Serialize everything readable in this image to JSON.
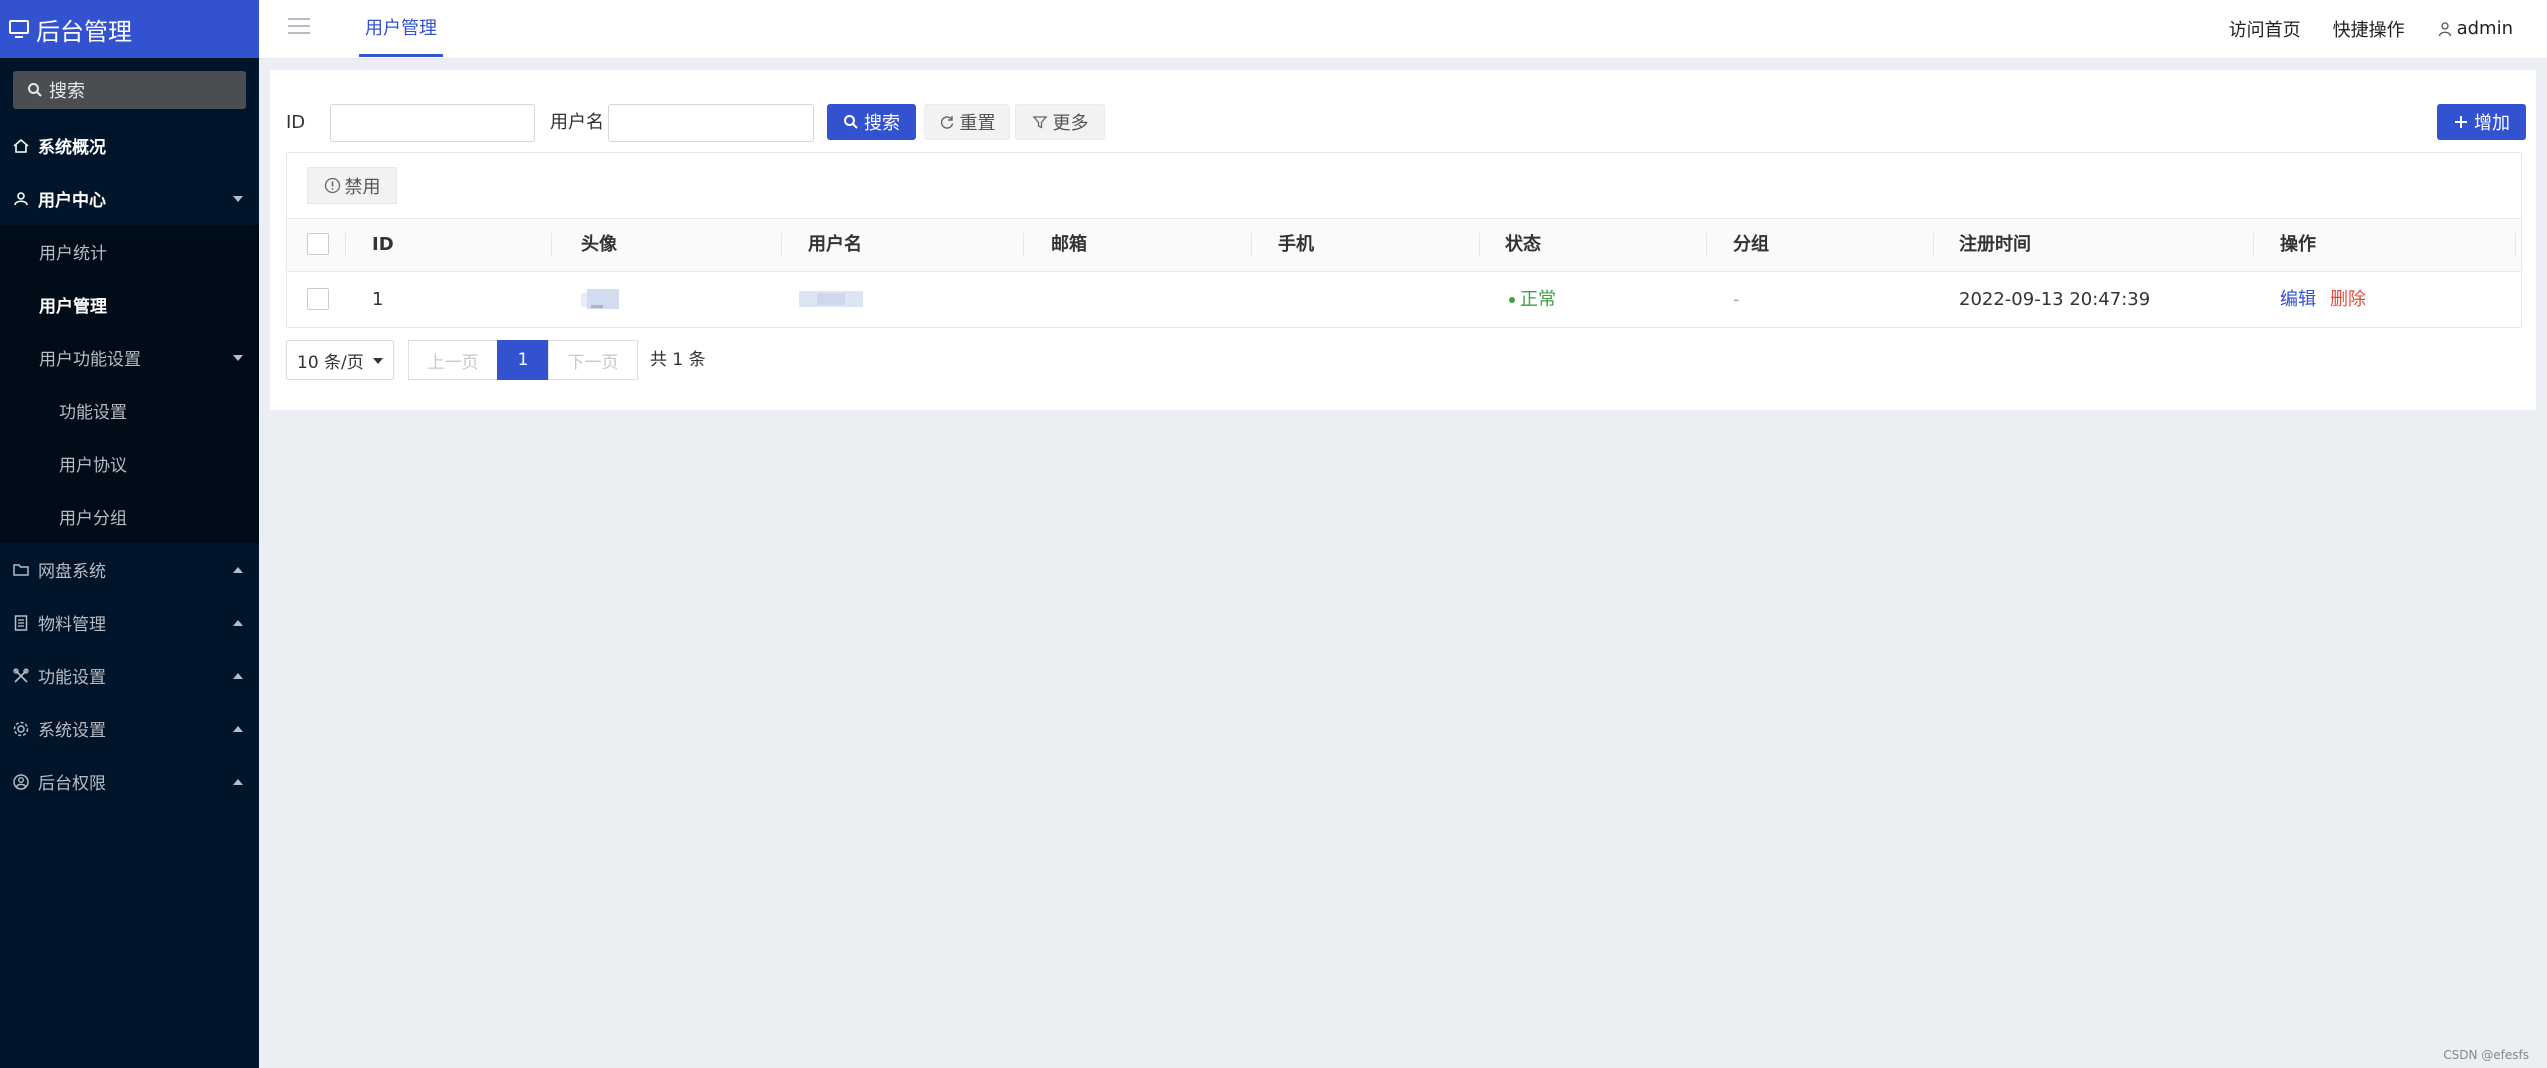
{
  "sidebar": {
    "brand": "后台管理",
    "search_label": "搜索",
    "items": [
      {
        "label": "系统概况"
      },
      {
        "label": "用户中心"
      },
      {
        "label": "网盘系统"
      },
      {
        "label": "物料管理"
      },
      {
        "label": "功能设置"
      },
      {
        "label": "系统设置"
      },
      {
        "label": "后台权限"
      }
    ],
    "user_center_sub": [
      {
        "label": "用户统计"
      },
      {
        "label": "用户管理"
      },
      {
        "label": "用户功能设置"
      }
    ],
    "user_func_sub": [
      {
        "label": "功能设置"
      },
      {
        "label": "用户协议"
      },
      {
        "label": "用户分组"
      }
    ]
  },
  "topbar": {
    "tab": "用户管理",
    "links": [
      "访问首页",
      "快捷操作"
    ],
    "user": "admin"
  },
  "filters": {
    "id_label": "ID",
    "id_value": "",
    "username_label": "用户名",
    "username_value": "",
    "search_btn": "搜索",
    "reset_btn": "重置",
    "more_btn": "更多",
    "add_btn": "增加"
  },
  "table": {
    "ban_btn": "禁用",
    "columns": [
      "ID",
      "头像",
      "用户名",
      "邮箱",
      "手机",
      "状态",
      "分组",
      "注册时间",
      "操作"
    ],
    "rows": [
      {
        "id": "1",
        "email": "",
        "phone": "",
        "status": "正常",
        "group": "-",
        "reg_time": "2022-09-13 20:47:39",
        "edit": "编辑",
        "delete": "删除"
      }
    ]
  },
  "pagination": {
    "page_size": "10 条/页",
    "prev": "上一页",
    "current": "1",
    "next": "下一页",
    "total": "共 1 条"
  },
  "watermark": "CSDN @efesfs",
  "colors": {
    "primary": "#3352d0",
    "sidebar": "#001529",
    "success": "#3aa540",
    "danger": "#e8483a"
  }
}
